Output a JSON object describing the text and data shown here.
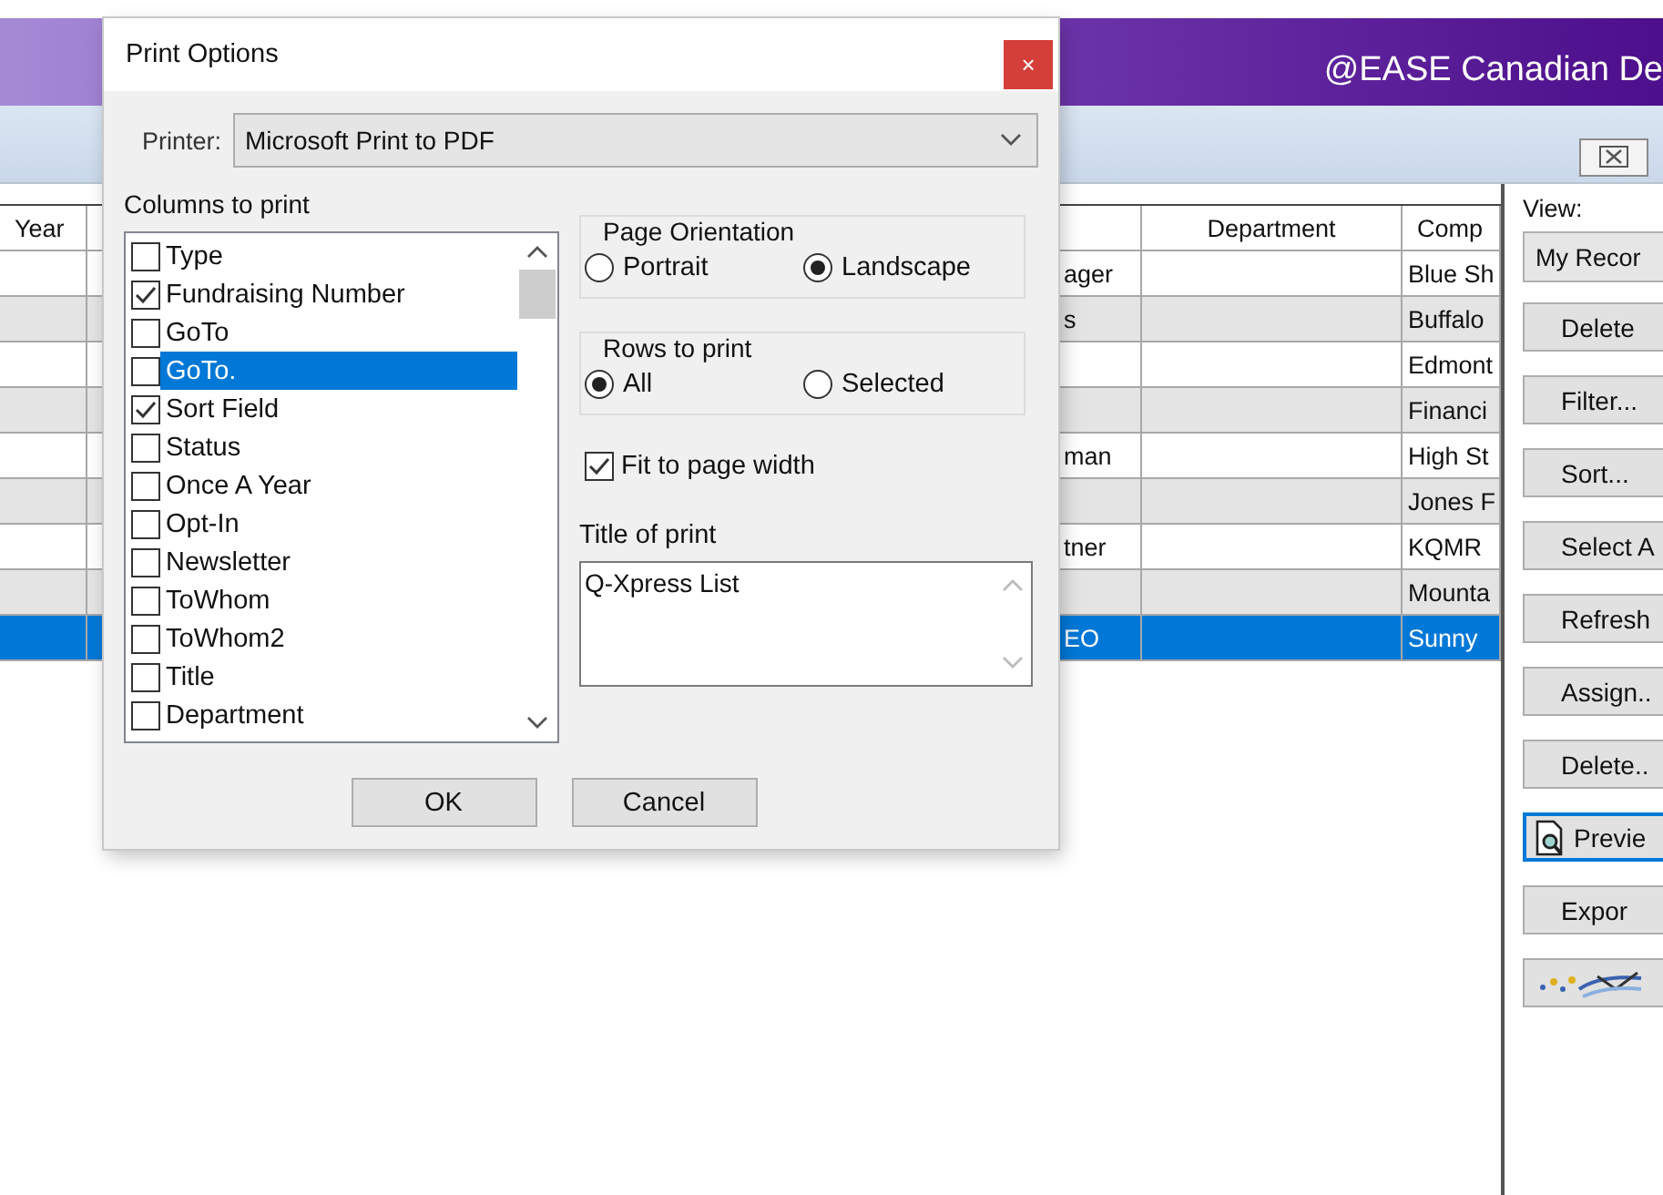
{
  "app": {
    "title": "@EASE Canadian De"
  },
  "grid": {
    "headers": {
      "year": "Year",
      "department": "Department",
      "column_5": "Comp"
    },
    "rows": [
      {
        "column_3": "ager",
        "column_5": "Blue Sh",
        "selected": false
      },
      {
        "column_3": "s",
        "column_5": "Buffalo",
        "selected": false
      },
      {
        "column_5": "Edmont",
        "selected": false
      },
      {
        "column_5": "Financi",
        "selected": false
      },
      {
        "column_3": "man",
        "column_5": "High St",
        "selected": false
      },
      {
        "column_5": "Jones F",
        "selected": false
      },
      {
        "column_3": "tner",
        "column_5": "KQMR",
        "selected": false
      },
      {
        "column_5": "Mounta",
        "selected": false
      },
      {
        "column_3": "EO",
        "column_5": "Sunny",
        "selected": true
      }
    ]
  },
  "side_panel": {
    "view_label": "View:",
    "view_value": "My Recor",
    "buttons": [
      {
        "kind": "text",
        "label": "Delete",
        "focused": false
      },
      {
        "kind": "text",
        "label": "Filter...",
        "focused": false
      },
      {
        "kind": "text",
        "label": "Sort...",
        "focused": false
      },
      {
        "kind": "text",
        "label": "Select A",
        "focused": false
      },
      {
        "kind": "text",
        "label": "Refresh",
        "focused": false
      },
      {
        "kind": "text",
        "label": "Assign..",
        "focused": false
      },
      {
        "kind": "text",
        "label": "Delete..",
        "focused": false
      },
      {
        "kind": "preview",
        "label": "Previe",
        "focused": true
      },
      {
        "kind": "text",
        "label": "Expor",
        "focused": false
      },
      {
        "kind": "image",
        "focused": false
      }
    ]
  },
  "dialog": {
    "title": "Print Options",
    "close": "×",
    "printer_label": "Printer:",
    "printer": "Microsoft Print to PDF",
    "columns_label": "Columns to print",
    "columns": [
      {
        "label": "Type",
        "checked": false,
        "selected": false
      },
      {
        "label": "Fundraising Number",
        "checked": true,
        "selected": false
      },
      {
        "label": "GoTo",
        "checked": false,
        "selected": false
      },
      {
        "label": "GoTo.",
        "checked": false,
        "selected": true
      },
      {
        "label": "Sort Field",
        "checked": true,
        "selected": false
      },
      {
        "label": "Status",
        "checked": false,
        "selected": false
      },
      {
        "label": "Once A Year",
        "checked": false,
        "selected": false
      },
      {
        "label": "Opt-In",
        "checked": false,
        "selected": false
      },
      {
        "label": "Newsletter",
        "checked": false,
        "selected": false
      },
      {
        "label": "ToWhom",
        "checked": false,
        "selected": false
      },
      {
        "label": "ToWhom2",
        "checked": false,
        "selected": false
      },
      {
        "label": "Title",
        "checked": false,
        "selected": false
      },
      {
        "label": "Department",
        "checked": false,
        "selected": false
      }
    ],
    "orientation": {
      "label": "Page Orientation",
      "options": [
        {
          "label": "Portrait",
          "selected": false
        },
        {
          "label": "Landscape",
          "selected": true
        }
      ]
    },
    "rows_to_print": {
      "label": "Rows to print",
      "options": [
        {
          "label": "All",
          "selected": true
        },
        {
          "label": "Selected",
          "selected": false
        }
      ]
    },
    "fit_to_page": {
      "label": "Fit to page width",
      "checked": true
    },
    "title_of_print": {
      "label": "Title of print",
      "value": "Q-Xpress List"
    },
    "buttons": [
      "OK",
      "Cancel"
    ]
  }
}
